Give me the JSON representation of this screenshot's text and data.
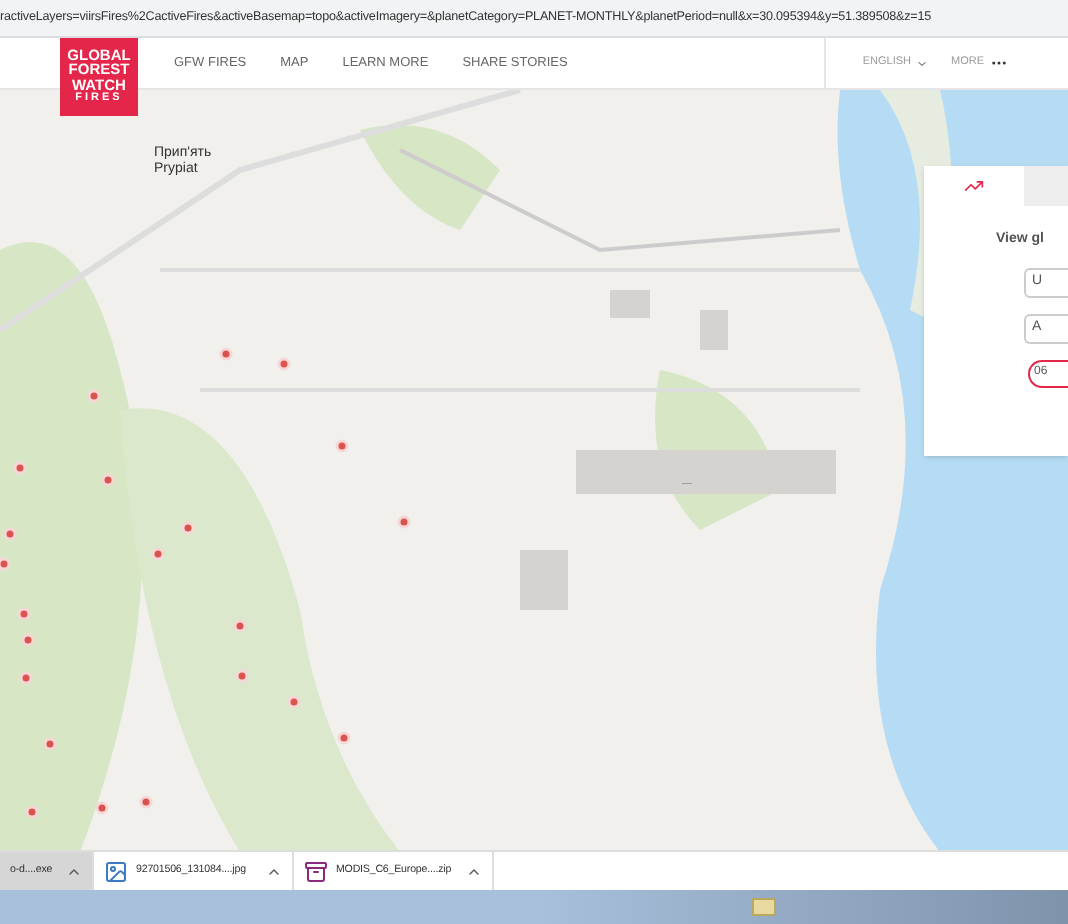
{
  "address_bar": {
    "url": "ractiveLayers=viirsFires%2CactiveFires&activeBasemap=topo&activeImagery=&planetCategory=PLANET-MONTHLY&planetPeriod=null&x=30.095394&y=51.389508&z=15"
  },
  "logo": {
    "lines": [
      "GLOBAL",
      "FOREST",
      "WATCH",
      "FIRES"
    ]
  },
  "nav": {
    "items": [
      "GFW FIRES",
      "MAP",
      "LEARN MORE",
      "SHARE STORIES"
    ],
    "language": "ENGLISH",
    "more": "MORE"
  },
  "map": {
    "place_labels": [
      "Прип'ять",
      "Prypiat"
    ],
    "road_label": "—"
  },
  "panel": {
    "heading": "View gl",
    "fields": [
      "U",
      "A"
    ],
    "date": "06"
  },
  "downloads": [
    {
      "kind": "exe",
      "name": "o-d....exe",
      "selected": true
    },
    {
      "kind": "image",
      "name": "92701506_131084....jpg",
      "selected": false
    },
    {
      "kind": "archive",
      "name": "MODIS_C6_Europe....zip",
      "selected": false
    }
  ]
}
